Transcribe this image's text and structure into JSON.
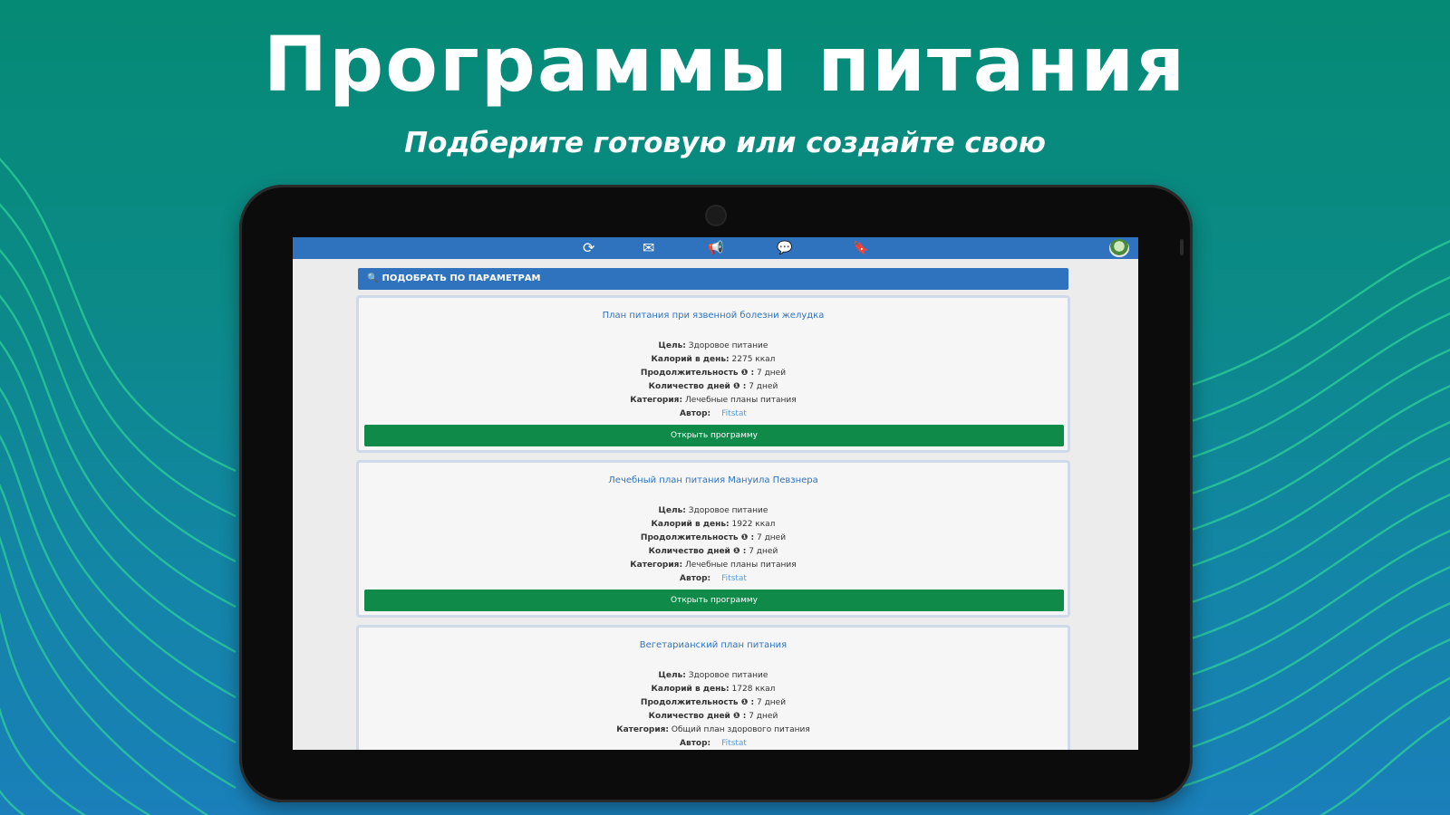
{
  "promo": {
    "title": "Программы питания",
    "subtitle": "Подберите готовую или создайте свою"
  },
  "toolbar": {
    "icons": [
      "refresh-icon",
      "mail-icon",
      "megaphone-icon",
      "chat-icon",
      "bookmark-icon",
      "avatar"
    ],
    "refresh_glyph": "⟳",
    "mail_glyph": "✉",
    "megaphone_glyph": "📢",
    "chat_glyph": "💬",
    "bookmark_glyph": "🔖"
  },
  "filter": {
    "icon": "search-icon",
    "icon_glyph": "🔍",
    "label": "ПОДОБРАТЬ ПО ПАРАМЕТРАМ"
  },
  "plans": [
    {
      "title": "План питания при язвенной болезни желудка",
      "goal_label": "Цель:",
      "goal": "Здоровое питание",
      "calories_label": "Калорий в день:",
      "calories": "2275 ккал",
      "duration_label": "Продолжительность ❶ :",
      "duration": "7 дней",
      "days_label": "Количество дней ❶ :",
      "days": "7 дней",
      "category_label": "Категория:",
      "category": "Лечебные планы питания",
      "author_label": "Автор:",
      "author": "Fitstat",
      "button": "Открыть программу"
    },
    {
      "title": "Лечебный план питания Мануила Певзнера",
      "goal_label": "Цель:",
      "goal": "Здоровое питание",
      "calories_label": "Калорий в день:",
      "calories": "1922 ккал",
      "duration_label": "Продолжительность ❶ :",
      "duration": "7 дней",
      "days_label": "Количество дней ❶ :",
      "days": "7 дней",
      "category_label": "Категория:",
      "category": "Лечебные планы питания",
      "author_label": "Автор:",
      "author": "Fitstat",
      "button": "Открыть программу"
    },
    {
      "title": "Вегетарианский план питания",
      "goal_label": "Цель:",
      "goal": "Здоровое питание",
      "calories_label": "Калорий в день:",
      "calories": "1728 ккал",
      "duration_label": "Продолжительность ❶ :",
      "duration": "7 дней",
      "days_label": "Количество дней ❶ :",
      "days": "7 дней",
      "category_label": "Категория:",
      "category": "Общий план здорового питания",
      "author_label": "Автор:",
      "author": "Fitstat"
    }
  ],
  "colors": {
    "accent_blue": "#2f73be",
    "button_green": "#108a48",
    "background_top": "#058a75",
    "background_bottom": "#1a7fba"
  }
}
